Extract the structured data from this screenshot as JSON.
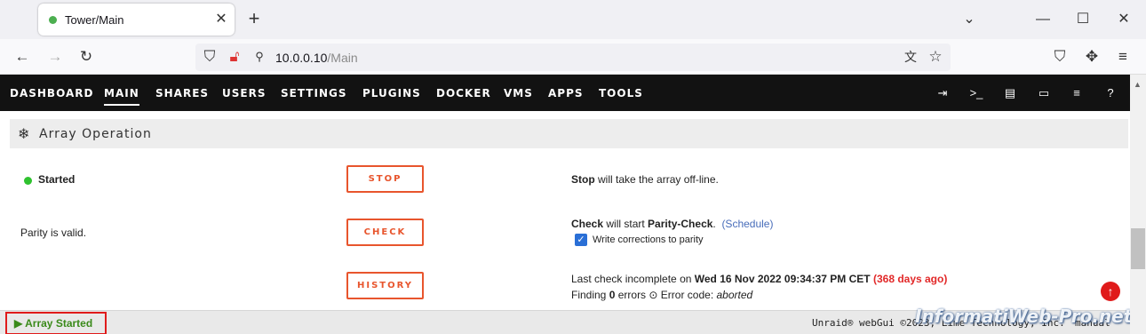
{
  "browser": {
    "tab_title": "Tower/Main",
    "tab_close": "✕",
    "new_tab": "+",
    "url_host": "10.0.0.10",
    "url_path": "/Main",
    "window_controls": [
      "⌄",
      "—",
      "☐",
      "✕"
    ]
  },
  "unraid_nav": {
    "items": [
      "DASHBOARD",
      "MAIN",
      "SHARES",
      "USERS",
      "SETTINGS",
      "PLUGINS",
      "DOCKER",
      "VMS",
      "APPS",
      "TOOLS"
    ],
    "active": "MAIN",
    "icons": [
      "logout-icon",
      "terminal-icon",
      "feedback-icon",
      "info-icon",
      "log-icon",
      "help-icon"
    ]
  },
  "section": {
    "icon": "❄",
    "title": "Array Operation"
  },
  "rows": {
    "status_label": "Started",
    "stop_button": "STOP",
    "stop_desc_bold": "Stop",
    "stop_desc": " will take the array off-line.",
    "parity_text": "Parity is valid.",
    "check_button": "CHECK",
    "check_desc_bold1": "Check",
    "check_desc_mid": " will start ",
    "check_desc_bold2": "Parity-Check",
    "check_desc_end": ".",
    "schedule_link": "(Schedule)",
    "write_corrections_label": "Write corrections to parity",
    "write_corrections_checked": true,
    "history_button": "HISTORY",
    "last_check_prefix": "Last check incomplete on ",
    "last_check_date": "Wed 16 Nov 2022 09:34:37 PM CET",
    "last_check_ago": "(368 days ago)",
    "finding_prefix": "Finding ",
    "finding_count": "0",
    "finding_suffix": " errors ",
    "error_code_label": " Error code: ",
    "error_code_value": "aborted"
  },
  "footer": {
    "status": "Array Started",
    "copyright": "Unraid® webGui ©2023, Lime Technology, Inc.",
    "manual": "manual",
    "watermark": "InformatiWeb-Pro.net"
  },
  "colors": {
    "accent": "#e8552d",
    "started_green": "#2fc22f",
    "header_bg": "#121212",
    "link": "#486dba",
    "alert_red": "#e22828"
  }
}
